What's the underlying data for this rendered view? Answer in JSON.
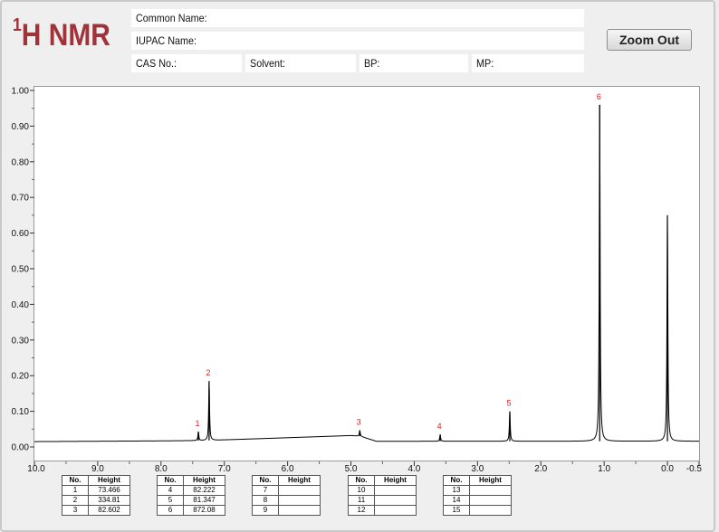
{
  "header": {
    "logo_sup": "1",
    "logo_text": "H NMR",
    "common_name_label": "Common Name:",
    "iupac_name_label": "IUPAC Name:",
    "cas_label": "CAS No.:",
    "solvent_label": "Solvent:",
    "bp_label": "BP:",
    "mp_label": "MP:",
    "zoom_out_label": "Zoom Out"
  },
  "colors": {
    "logo": "#a0323a",
    "peak_label": "#e0201e",
    "spectrum_line": "#000000"
  },
  "chart_data": {
    "type": "line",
    "title": "",
    "xlabel": "",
    "ylabel": "",
    "x_reversed": true,
    "xlim": [
      10.0,
      -0.5
    ],
    "ylim": [
      0.0,
      1.0
    ],
    "x_ticks": [
      "10.0",
      "9.0",
      "8.0",
      "7.0",
      "6.0",
      "5.0",
      "4.0",
      "3.0",
      "2.0",
      "1.0",
      "0.0",
      "-0.5"
    ],
    "x_tick_values": [
      10.0,
      9.0,
      8.0,
      7.0,
      6.0,
      5.0,
      4.0,
      3.0,
      2.0,
      1.0,
      0.0,
      -0.5
    ],
    "y_ticks": [
      "1.00",
      "0.90",
      "0.80",
      "0.70",
      "0.60",
      "0.50",
      "0.40",
      "0.30",
      "0.20",
      "0.10",
      "0.00"
    ],
    "y_tick_values": [
      1.0,
      0.9,
      0.8,
      0.7,
      0.6,
      0.5,
      0.4,
      0.3,
      0.2,
      0.1,
      0.0
    ],
    "baseline": [
      [
        10.0,
        0.015
      ],
      [
        8.0,
        0.017
      ],
      [
        7.3,
        0.018
      ],
      [
        5.0,
        0.032
      ],
      [
        4.85,
        0.03
      ],
      [
        4.6,
        0.016
      ],
      [
        3.0,
        0.016
      ],
      [
        0.1,
        0.016
      ],
      [
        -0.5,
        0.016
      ]
    ],
    "peaks": [
      {
        "label": "1",
        "ppm": 7.41,
        "intensity": 0.043
      },
      {
        "label": "2",
        "ppm": 7.24,
        "intensity": 0.185
      },
      {
        "label": "3",
        "ppm": 4.86,
        "intensity": 0.047
      },
      {
        "label": "4",
        "ppm": 3.59,
        "intensity": 0.035
      },
      {
        "label": "5",
        "ppm": 2.49,
        "intensity": 0.1
      },
      {
        "label": "6",
        "ppm": 1.07,
        "intensity": 0.96
      }
    ],
    "reference_peak": {
      "ppm": 0.0,
      "intensity": 0.65
    },
    "peak_tables": [
      {
        "rows": [
          [
            "1",
            "73.466"
          ],
          [
            "2",
            "334.81"
          ],
          [
            "3",
            "82.602"
          ]
        ]
      },
      {
        "rows": [
          [
            "4",
            "82.222"
          ],
          [
            "5",
            "81.347"
          ],
          [
            "6",
            "872.08"
          ]
        ]
      },
      {
        "rows": [
          [
            "7",
            ""
          ],
          [
            "8",
            ""
          ],
          [
            "9",
            ""
          ]
        ]
      },
      {
        "rows": [
          [
            "10",
            ""
          ],
          [
            "11",
            ""
          ],
          [
            "12",
            ""
          ]
        ]
      },
      {
        "rows": [
          [
            "13",
            ""
          ],
          [
            "14",
            ""
          ],
          [
            "15",
            ""
          ]
        ]
      }
    ],
    "table_header_no": "No.",
    "table_header_height": "Height"
  }
}
